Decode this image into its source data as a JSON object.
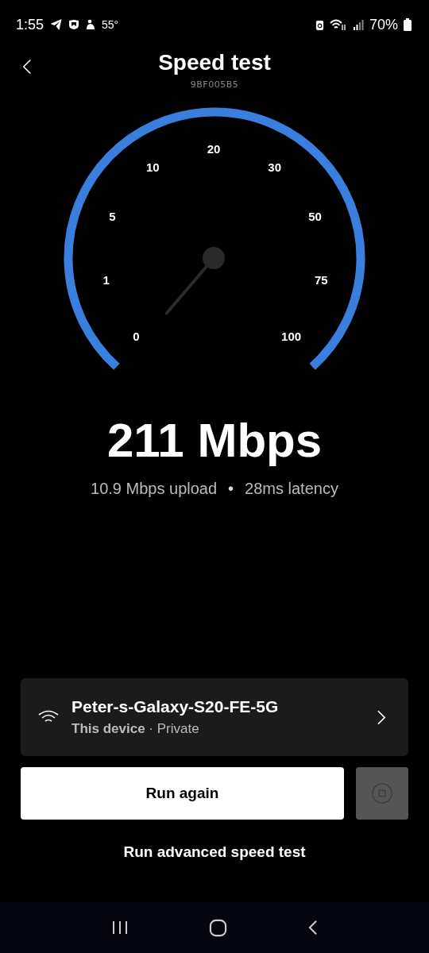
{
  "status_bar": {
    "time": "1:55",
    "temperature": "55°",
    "battery": "70%"
  },
  "header": {
    "title": "Speed test",
    "subtitle": "9BF005B5"
  },
  "gauge": {
    "scale": [
      "0",
      "1",
      "5",
      "10",
      "20",
      "30",
      "50",
      "75",
      "100"
    ]
  },
  "result": {
    "download": "211 Mbps",
    "upload": "10.9 Mbps upload",
    "separator": "•",
    "latency": "28ms latency"
  },
  "network": {
    "name": "Peter-s-Galaxy-S20-FE-5G",
    "device": "This device",
    "privacy": "· Private"
  },
  "buttons": {
    "run_again": "Run again",
    "advanced": "Run advanced speed test"
  }
}
